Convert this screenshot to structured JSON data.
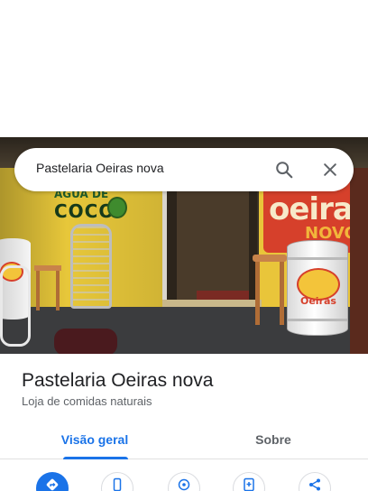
{
  "search": {
    "query": "Pastelaria Oeiras nova",
    "search_icon": "search-icon",
    "close_icon": "close-icon"
  },
  "photo": {
    "wall_text_top": "AGUA DE",
    "wall_text_bottom": "COCO",
    "banner_line1": "oeiras",
    "banner_line2": "NOVO",
    "barrel_logo_text": "Oeiras"
  },
  "place": {
    "name": "Pastelaria Oeiras nova",
    "category": "Loja de comidas naturais"
  },
  "tabs": [
    {
      "label": "Visão geral",
      "active": true
    },
    {
      "label": "Sobre",
      "active": false
    }
  ],
  "actions": [
    {
      "icon": "directions-icon",
      "primary": true
    },
    {
      "icon": "phone-icon",
      "primary": false
    },
    {
      "icon": "location-icon",
      "primary": false
    },
    {
      "icon": "save-icon",
      "primary": false
    },
    {
      "icon": "share-icon",
      "primary": false
    }
  ],
  "colors": {
    "accent": "#1a73e8",
    "text_primary": "#202124",
    "text_secondary": "#5f6368"
  }
}
